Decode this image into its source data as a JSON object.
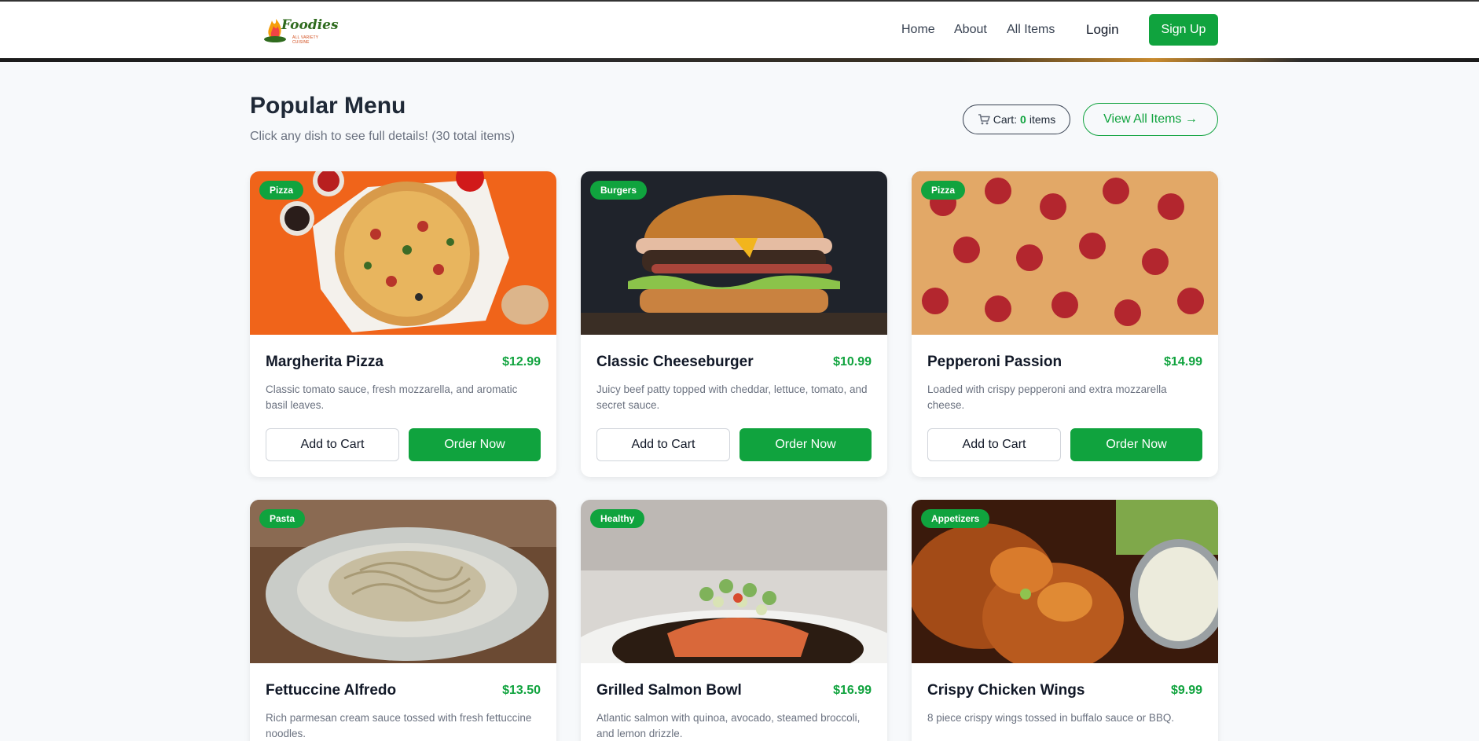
{
  "header": {
    "logo_text": "Foodies",
    "logo_tagline": "ALL VARIETY CUISINE",
    "nav": [
      "Home",
      "About",
      "All Items"
    ],
    "login": "Login",
    "signup": "Sign Up"
  },
  "section": {
    "title": "Popular Menu",
    "subtitle": "Click any dish to see full details! (30 total items)",
    "cart_prefix": "Cart:",
    "cart_count": "0",
    "cart_suffix": "items",
    "view_all": "View All Items →"
  },
  "buttons": {
    "add": "Add to Cart",
    "order": "Order Now"
  },
  "items": [
    {
      "category": "Pizza",
      "name": "Margherita Pizza",
      "price": "$12.99",
      "desc": "Classic tomato sauce, fresh mozzarella, and aromatic basil leaves."
    },
    {
      "category": "Burgers",
      "name": "Classic Cheeseburger",
      "price": "$10.99",
      "desc": "Juicy beef patty topped with cheddar, lettuce, tomato, and secret sauce."
    },
    {
      "category": "Pizza",
      "name": "Pepperoni Passion",
      "price": "$14.99",
      "desc": "Loaded with crispy pepperoni and extra mozzarella cheese."
    },
    {
      "category": "Pasta",
      "name": "Fettuccine Alfredo",
      "price": "$13.50",
      "desc": "Rich parmesan cream sauce tossed with fresh fettuccine noodles."
    },
    {
      "category": "Healthy",
      "name": "Grilled Salmon Bowl",
      "price": "$16.99",
      "desc": "Atlantic salmon with quinoa, avocado, steamed broccoli, and lemon drizzle."
    },
    {
      "category": "Appetizers",
      "name": "Crispy Chicken Wings",
      "price": "$9.99",
      "desc": "8 piece crispy wings tossed in buffalo sauce or BBQ."
    }
  ]
}
